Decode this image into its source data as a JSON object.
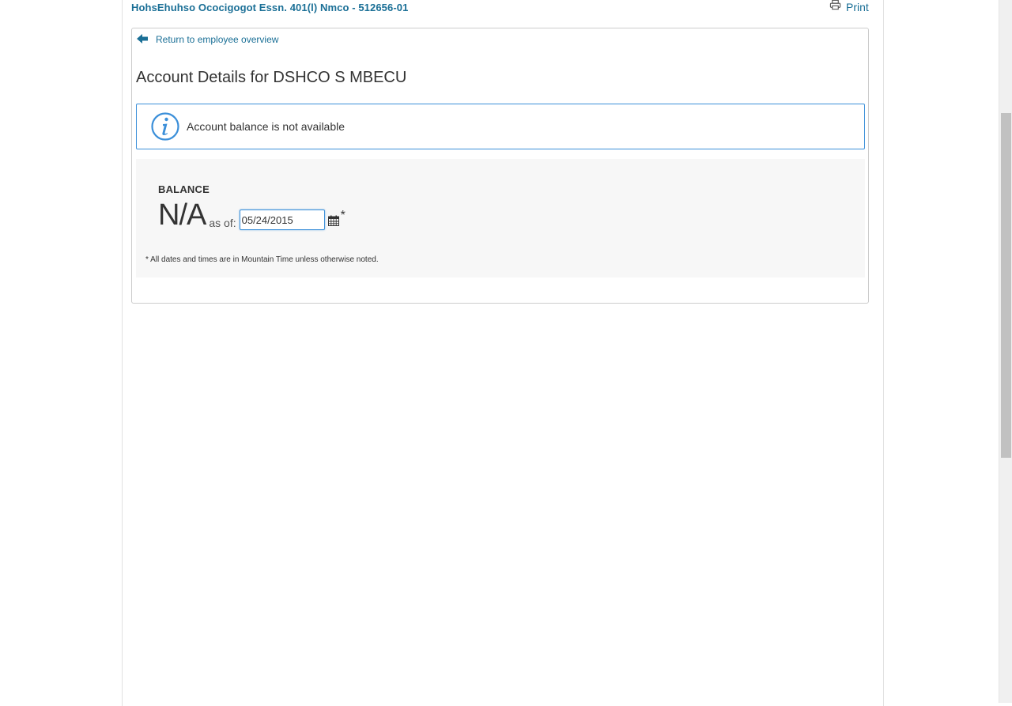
{
  "header": {
    "plan_title": "HohsEhuhso Ococigogot Essn. 401(l) Nmco - 512656-01",
    "print_label": "Print"
  },
  "panel": {
    "back_link": "Return to employee overview",
    "title": "Account Details for DSHCO S MBECU",
    "alert_message": "Account balance is not available",
    "balance_label": "BALANCE",
    "balance_value": "N/A",
    "as_of_label": "as of:",
    "as_of_date": "05/24/2015",
    "asterisk": "*",
    "footnote": "* All dates and times are in Mountain Time unless otherwise noted."
  },
  "colors": {
    "link": "#1a6f96",
    "info_border": "#3b8fd9",
    "balance_bg": "#f7f7f7"
  },
  "icons": {
    "print": "printer-icon",
    "back": "arrow-left-icon",
    "alert": "info-icon",
    "date": "calendar-icon"
  }
}
